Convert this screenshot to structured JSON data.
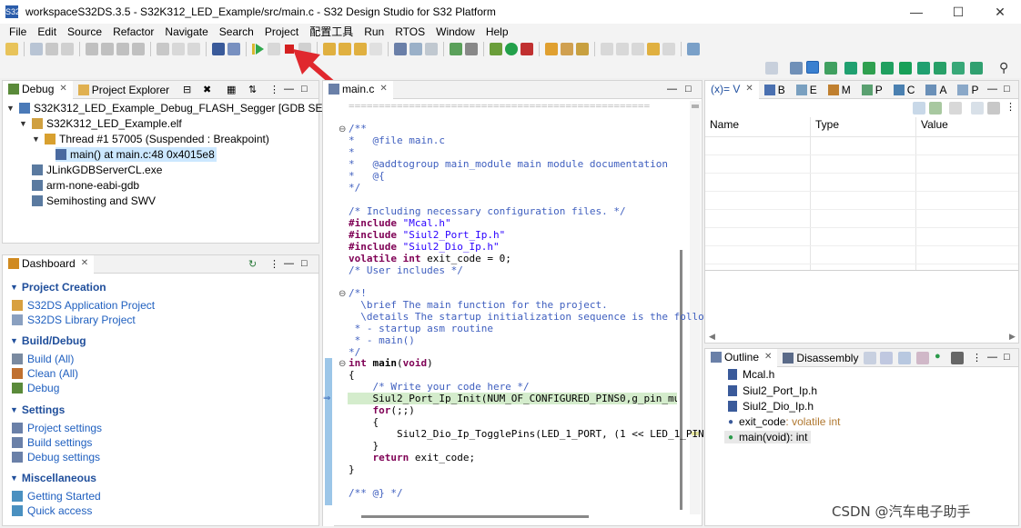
{
  "window": {
    "title": "workspaceS32DS.3.5 - S32K312_LED_Example/src/main.c - S32 Design Studio for S32 Platform",
    "icon_text": "S32"
  },
  "menu": [
    "File",
    "Edit",
    "Source",
    "Refactor",
    "Navigate",
    "Search",
    "Project",
    "配置工具",
    "Run",
    "RTOS",
    "Window",
    "Help"
  ],
  "debug_panel": {
    "tabs": [
      {
        "label": "Debug"
      },
      {
        "label": "Project Explorer"
      }
    ],
    "tree": [
      {
        "label": "S32K312_LED_Example_Debug_FLASH_Segger [GDB SEGGER J-L"
      },
      {
        "label": "S32K312_LED_Example.elf"
      },
      {
        "label": "Thread #1 57005 (Suspended : Breakpoint)"
      },
      {
        "label": "main() at main.c:48 0x4015e8"
      },
      {
        "label": "JLinkGDBServerCL.exe"
      },
      {
        "label": "arm-none-eabi-gdb"
      },
      {
        "label": "Semihosting and SWV"
      }
    ]
  },
  "dashboard": {
    "tab": "Dashboard",
    "sections": [
      {
        "title": "Project Creation",
        "items": [
          "S32DS Application Project",
          "S32DS Library Project"
        ]
      },
      {
        "title": "Build/Debug",
        "items": [
          "Build  (All)",
          "Clean  (All)",
          "Debug"
        ]
      },
      {
        "title": "Settings",
        "items": [
          "Project settings",
          "Build settings",
          "Debug settings"
        ]
      },
      {
        "title": "Miscellaneous",
        "items": [
          "Getting Started",
          "Quick access"
        ]
      }
    ]
  },
  "editor": {
    "tab": "main.c"
  },
  "vars_panel": {
    "tabs": [
      "(x)= V",
      "B",
      "E",
      "M",
      "P",
      "C",
      "A",
      "P"
    ],
    "columns": [
      "Name",
      "Type",
      "Value"
    ]
  },
  "outline_panel": {
    "tabs": [
      "Outline",
      "Disassembly"
    ],
    "items": [
      {
        "name": "Mcal.h",
        "type": ""
      },
      {
        "name": "Siul2_Port_Ip.h",
        "type": ""
      },
      {
        "name": "Siul2_Dio_Ip.h",
        "type": ""
      },
      {
        "name": "exit_code",
        "type": " : volatile int"
      },
      {
        "name": "main(void)",
        "type": " : int"
      }
    ]
  },
  "watermark": "CSDN @汽车电子助手",
  "colors": {
    "accent": "#1f4e9b",
    "link": "#1f5fbf",
    "arrow": "#e0282e",
    "highlight": "#d4eccc",
    "selection": "#cce8ff"
  }
}
